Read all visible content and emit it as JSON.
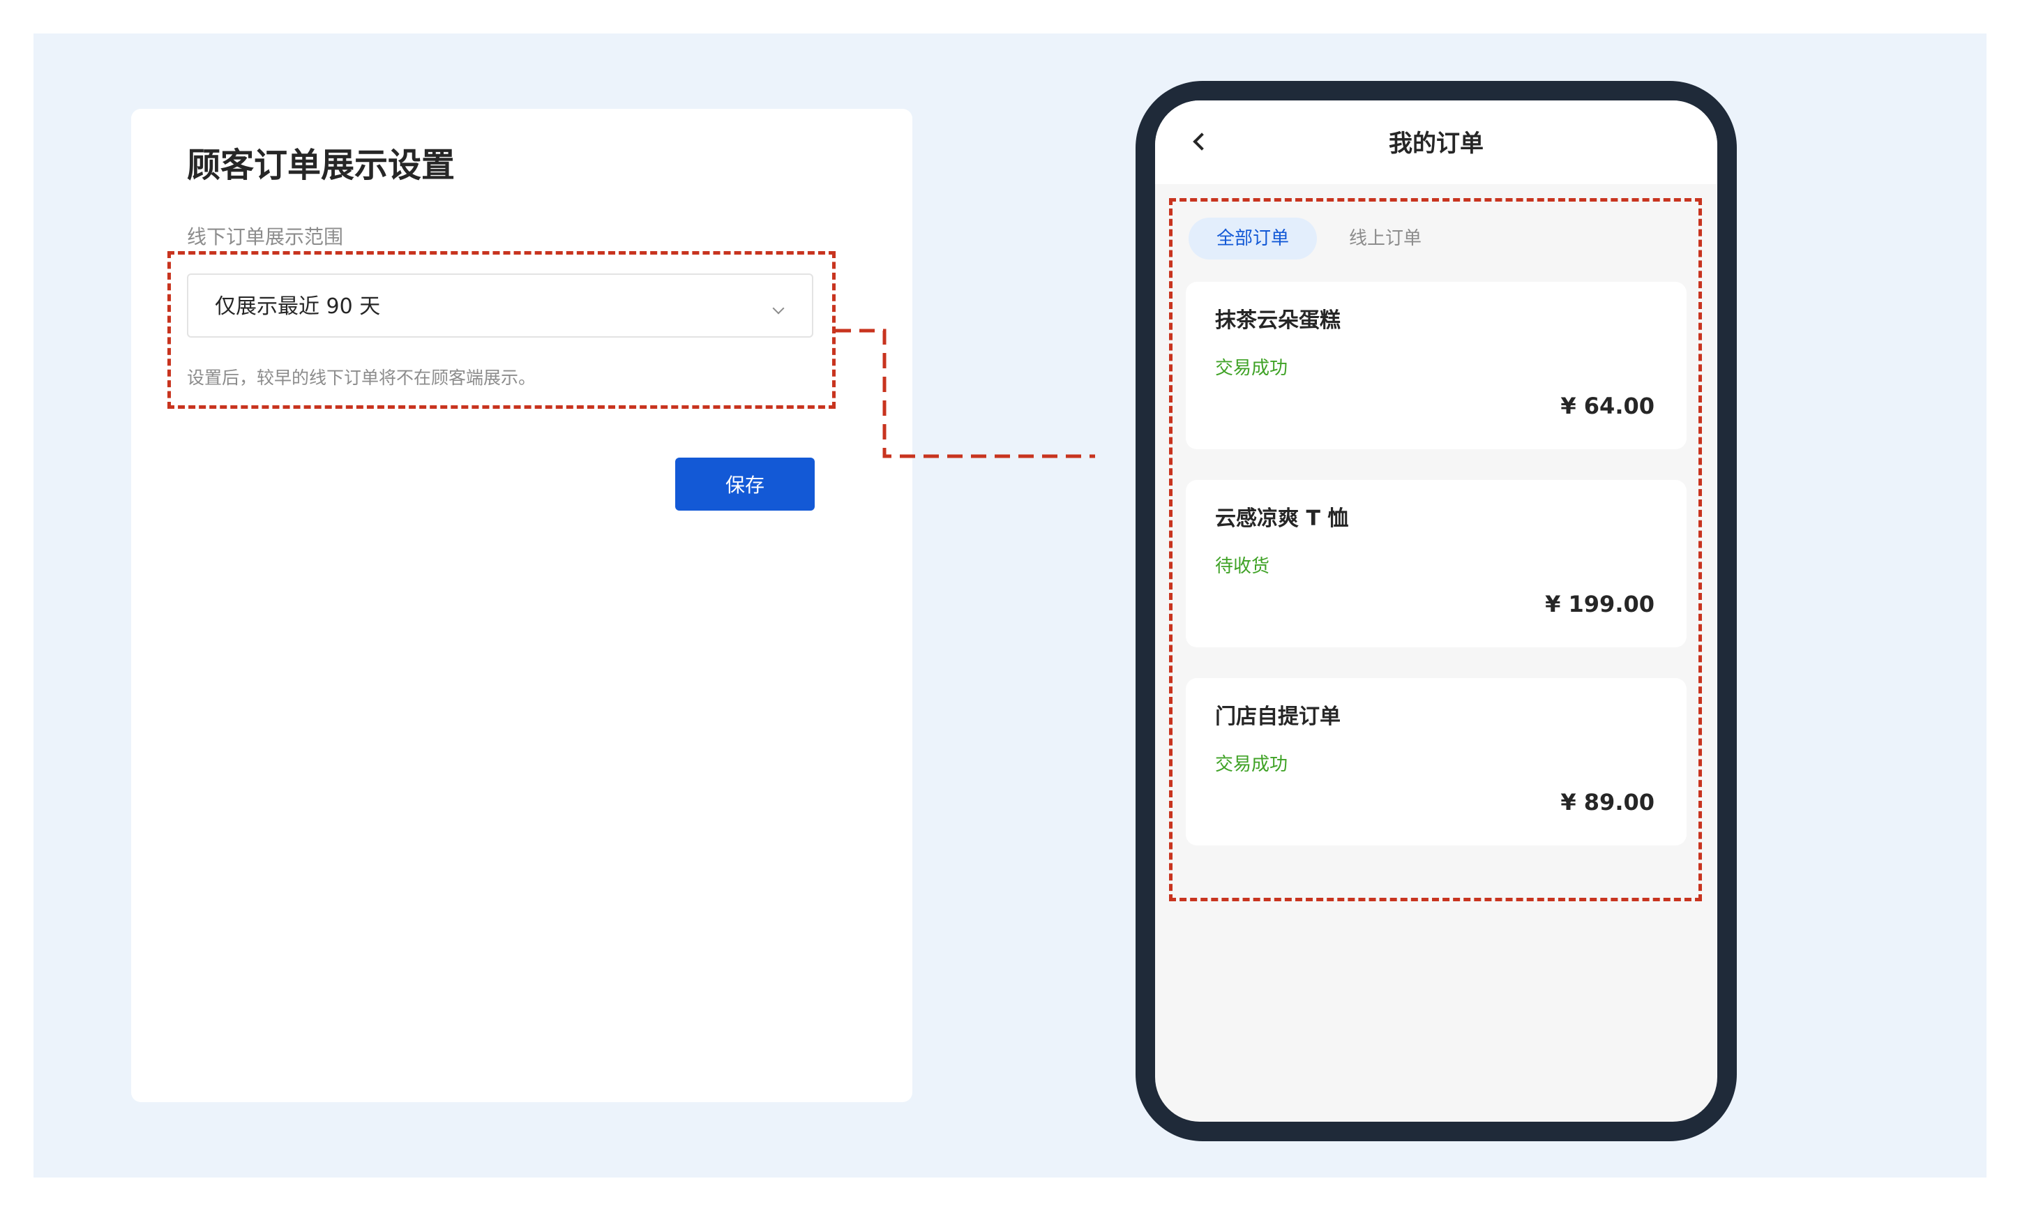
{
  "settings": {
    "title": "顾客订单展示设置",
    "field_label": "线下订单展示范围",
    "selected_value": "仅展示最近 90 天",
    "helper_text": "设置后，较早的线下订单将不在顾客端展示。",
    "save_label": "保存"
  },
  "phone": {
    "title": "我的订单",
    "tabs": [
      {
        "label": "全部订单",
        "active": true
      },
      {
        "label": "线上订单",
        "active": false
      }
    ],
    "orders": [
      {
        "name": "抹茶云朵蛋糕",
        "status": "交易成功",
        "price": "¥ 64.00"
      },
      {
        "name": "云感凉爽 T 恤",
        "status": "待收货",
        "price": "¥ 199.00"
      },
      {
        "name": "门店自提订单",
        "status": "交易成功",
        "price": "¥ 89.00"
      }
    ]
  },
  "colors": {
    "background": "#ecf3fb",
    "primary": "#1359d6",
    "highlight": "#c8341f",
    "status_green": "#3fa226",
    "phone_frame": "#1f2a39"
  }
}
